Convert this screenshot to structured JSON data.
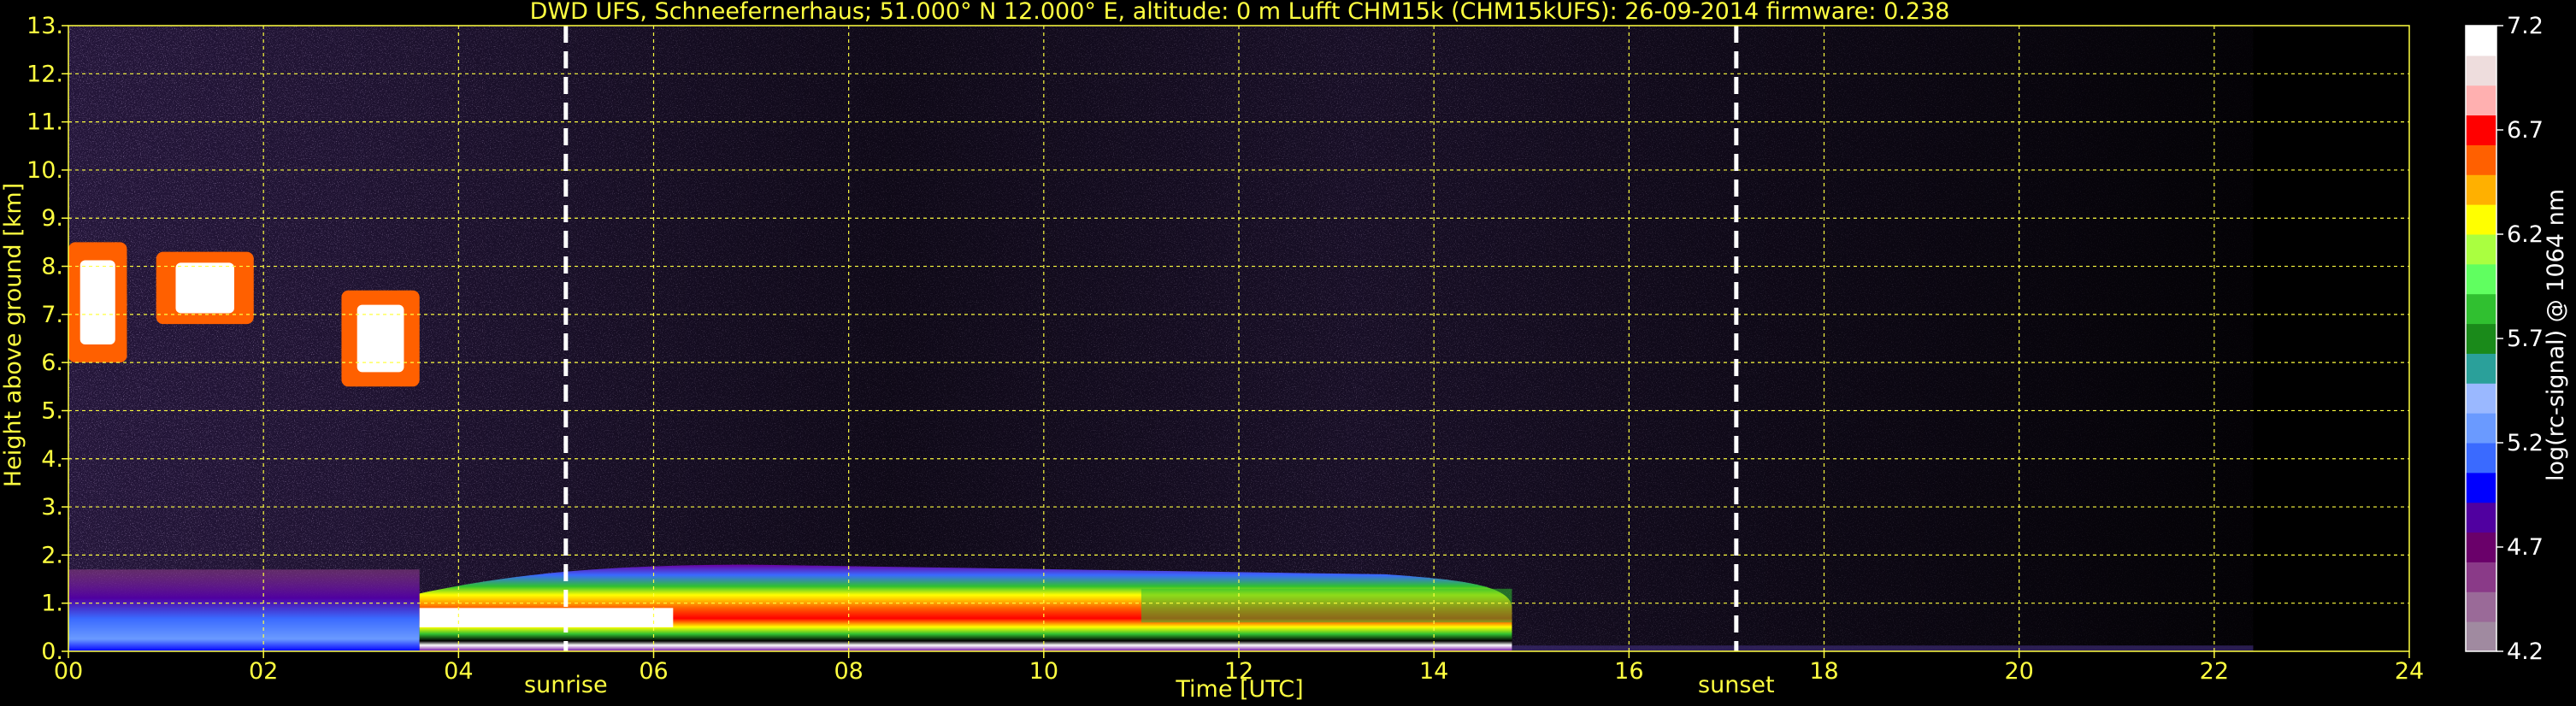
{
  "chart_data": {
    "type": "heatmap",
    "title": "DWD UFS, Schneefernerhaus; 51.000° N 12.000° E, altitude: 0 m    Lufft CHM15k (CHM15kUFS): 26-09-2014    firmware: 0.238",
    "xlabel": "Time [UTC]",
    "ylabel": "Height above ground [km]",
    "xlim": [
      0,
      24
    ],
    "ylim": [
      0,
      13
    ],
    "x_ticks": [
      "00",
      "02",
      "04",
      "06",
      "08",
      "10",
      "12",
      "14",
      "16",
      "18",
      "20",
      "22",
      "24"
    ],
    "y_ticks": [
      "0.",
      "1.",
      "2.",
      "3.",
      "4.",
      "5.",
      "6.",
      "7.",
      "8.",
      "9.",
      "10.",
      "11.",
      "12.",
      "13."
    ],
    "grid": true,
    "colorbar": {
      "label": "log(rc-signal) @ 1064 nm",
      "range": [
        4.2,
        7.2
      ],
      "ticks": [
        "4.2",
        "4.7",
        "5.2",
        "5.7",
        "6.2",
        "6.7",
        "7.2"
      ],
      "colors": [
        "#a08aa0",
        "#9a6a98",
        "#8a3a88",
        "#6a006a",
        "#5000a0",
        "#0000ff",
        "#3a6aff",
        "#6a9aff",
        "#9ab8ff",
        "#2aa09a",
        "#1a8a1a",
        "#30c030",
        "#60ff60",
        "#aaff40",
        "#ffff00",
        "#ffb000",
        "#ff6000",
        "#ff0000",
        "#ffb0b0",
        "#eedddd",
        "#ffffff"
      ]
    },
    "annotations": [
      {
        "text": "sunrise",
        "x": 5.1
      },
      {
        "text": "sunset",
        "x": 17.1
      }
    ],
    "data_end_time": 22.4,
    "layers": [
      {
        "feature": "boundary layer aerosol",
        "x_start": 0.0,
        "x_end": 14.8,
        "height_min": 0.0,
        "height_max": 1.8,
        "signal": "high"
      },
      {
        "feature": "cloud",
        "x_start": 0.0,
        "x_end": 0.6,
        "height_min": 6.0,
        "height_max": 8.5,
        "signal": "very high"
      },
      {
        "feature": "cloud",
        "x_start": 0.9,
        "x_end": 1.9,
        "height_min": 6.8,
        "height_max": 8.3,
        "signal": "very high"
      },
      {
        "feature": "cloud",
        "x_start": 2.8,
        "x_end": 3.6,
        "height_min": 5.5,
        "height_max": 7.5,
        "signal": "very high"
      }
    ]
  }
}
